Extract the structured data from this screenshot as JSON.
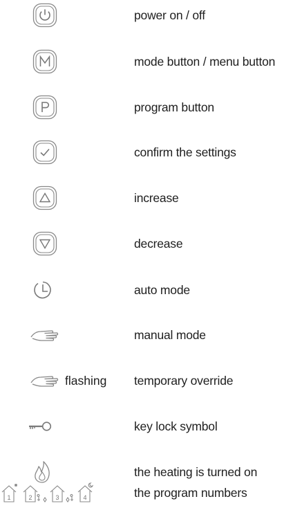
{
  "legend": [
    {
      "icon": "power-button-icon",
      "label": "power on / off"
    },
    {
      "icon": "mode-button-icon",
      "label": "mode button / menu button"
    },
    {
      "icon": "program-button-icon",
      "label": "program button"
    },
    {
      "icon": "confirm-button-icon",
      "label": "confirm the settings"
    },
    {
      "icon": "increase-button-icon",
      "label": "increase"
    },
    {
      "icon": "decrease-button-icon",
      "label": "decrease"
    },
    {
      "icon": "auto-mode-clock-icon",
      "label": "auto mode"
    },
    {
      "icon": "manual-mode-hand-icon",
      "label": "manual mode"
    },
    {
      "icon": "manual-mode-hand-icon",
      "extra": "flashing",
      "label": "temporary override"
    },
    {
      "icon": "key-lock-icon",
      "label": "key lock symbol"
    },
    {
      "icon": "flame-icon",
      "label": "the heating is turned on"
    },
    {
      "icon": "program-house-icons",
      "label": "the program numbers",
      "program_numbers": [
        "1",
        "2",
        "3",
        "4"
      ]
    }
  ]
}
